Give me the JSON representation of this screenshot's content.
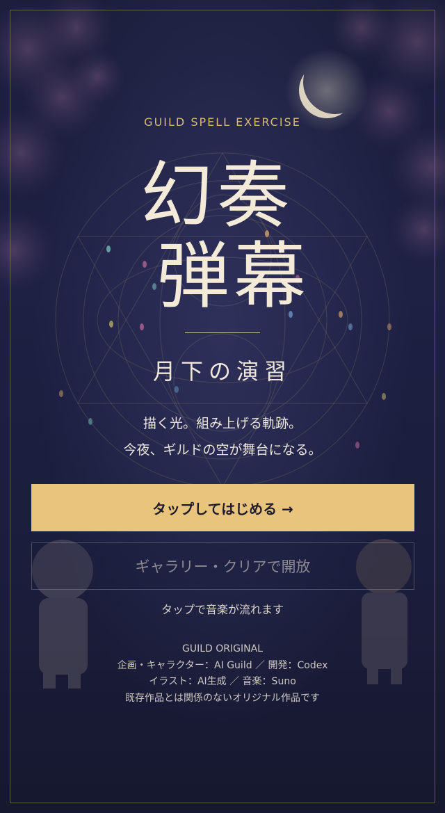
{
  "hero": {
    "eyebrow": "GUILD SPELL EXERCISE",
    "title_line_1": "幻奏",
    "title_line_2": "弾幕",
    "subtitle": "月下の演習",
    "tagline_1": "描く光。組み上げる軌跡。",
    "tagline_2": "今夜、ギルドの空が舞台になる。"
  },
  "actions": {
    "start_label": "タップしてはじめる →",
    "gallery_label": "ギャラリー・クリアで開放",
    "gallery_enabled": false
  },
  "hint": "タップで音楽が流れます",
  "credits": {
    "line_1": "GUILD ORIGINAL",
    "line_2": "企画・キャラクター：AI Guild ／ 開発：Codex",
    "line_3": "イラスト：AI生成 ／ 音楽：Suno",
    "line_4": "既存作品とは関係のないオリジナル作品です"
  },
  "colors": {
    "background": "#1e2044",
    "accent_gold": "#e8c47d",
    "eyebrow_gold": "#d9b877",
    "title_text": "#f3ead7"
  },
  "icons": {
    "moon": "crescent-moon-icon",
    "magic_circle": "magic-circle-icon"
  }
}
